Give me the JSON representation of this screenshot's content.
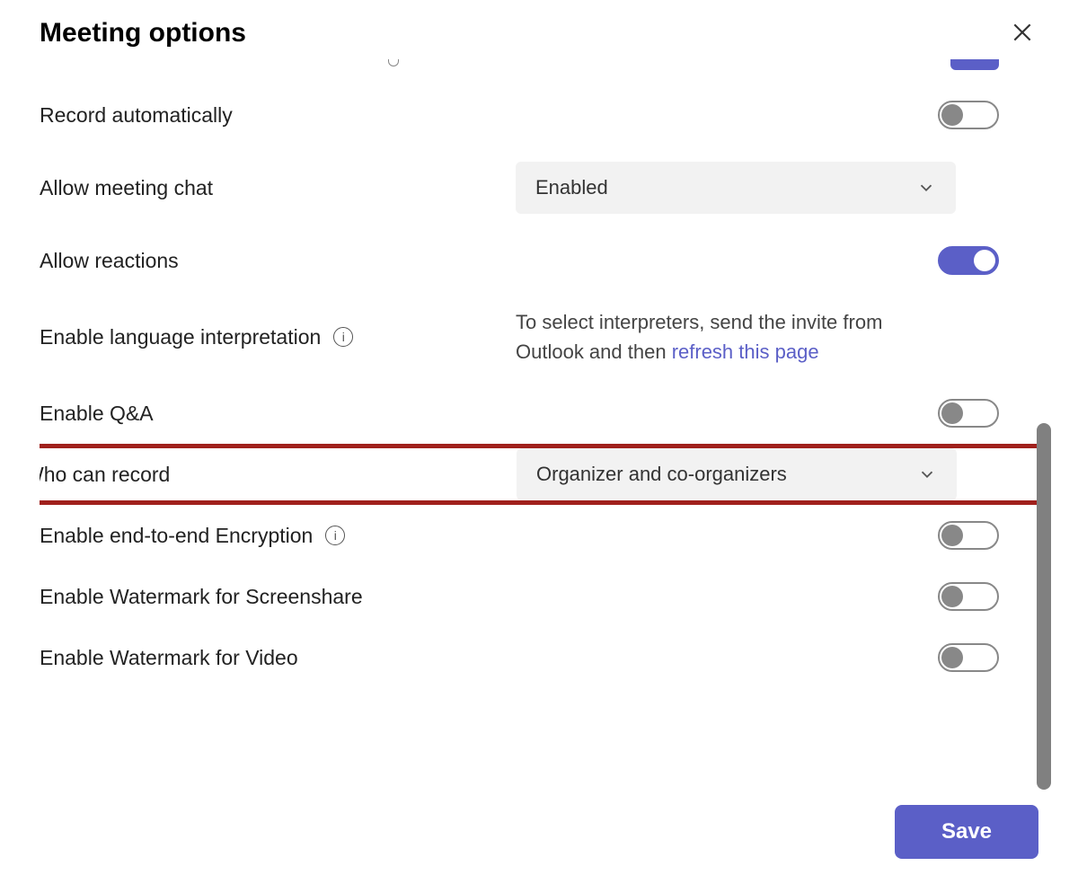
{
  "header": {
    "title": "Meeting options"
  },
  "rows": {
    "record_auto": {
      "label": "Record automatically",
      "toggle": "off"
    },
    "allow_chat": {
      "label": "Allow meeting chat",
      "value": "Enabled"
    },
    "allow_reactions": {
      "label": "Allow reactions",
      "toggle": "on"
    },
    "lang_interp": {
      "label": "Enable language interpretation",
      "hint_prefix": "To select interpreters, send the invite from Outlook and then ",
      "hint_link": "refresh this page"
    },
    "enable_qa": {
      "label": "Enable Q&A",
      "toggle": "off"
    },
    "who_record": {
      "label": "Who can record",
      "value": "Organizer and co-organizers"
    },
    "e2e_encrypt": {
      "label": "Enable end-to-end Encryption",
      "toggle": "off"
    },
    "wm_screenshare": {
      "label": "Enable Watermark for Screenshare",
      "toggle": "off"
    },
    "wm_video": {
      "label": "Enable Watermark for Video",
      "toggle": "off"
    }
  },
  "footer": {
    "save": "Save"
  },
  "colors": {
    "accent": "#5b5fc7",
    "highlight_border": "#a0201c"
  }
}
